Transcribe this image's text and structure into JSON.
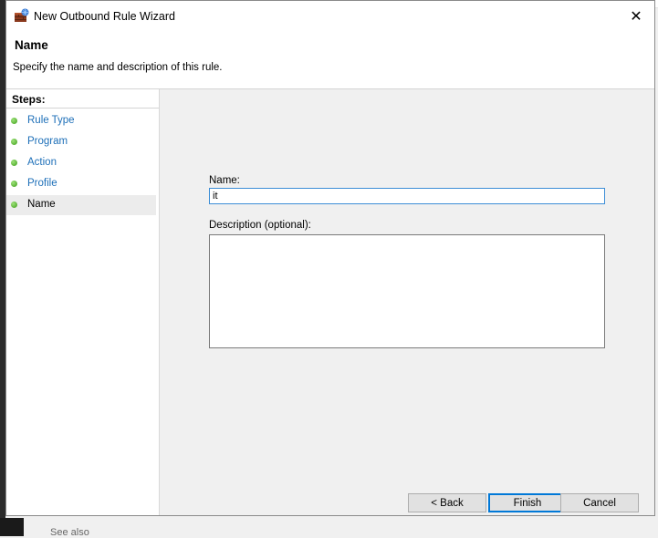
{
  "window": {
    "title": "New Outbound Rule Wizard",
    "close_glyph": "✕"
  },
  "header": {
    "title": "Name",
    "description": "Specify the name and description of this rule."
  },
  "steps": {
    "label": "Steps:",
    "items": [
      {
        "label": "Rule Type",
        "status": "complete"
      },
      {
        "label": "Program",
        "status": "complete"
      },
      {
        "label": "Action",
        "status": "complete"
      },
      {
        "label": "Profile",
        "status": "complete"
      },
      {
        "label": "Name",
        "status": "current"
      }
    ]
  },
  "form": {
    "name_label": "Name:",
    "name_value": "it",
    "description_label": "Description (optional):",
    "description_value": ""
  },
  "buttons": {
    "back": "< Back",
    "finish": "Finish",
    "cancel": "Cancel"
  },
  "background": {
    "see_also": "See also"
  },
  "colors": {
    "link": "#1d6fb8",
    "step_dot": "#3f9e1a",
    "focus_border": "#0078d7"
  }
}
